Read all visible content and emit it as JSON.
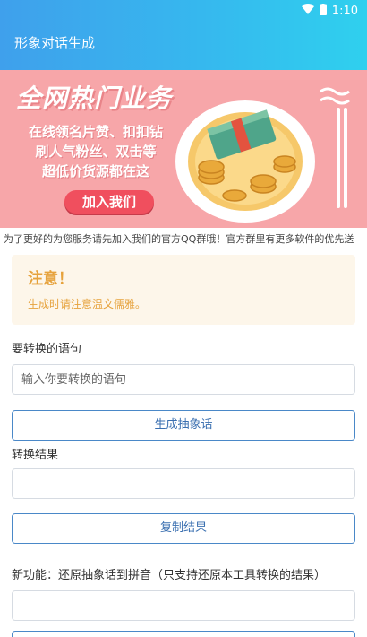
{
  "status": {
    "time": "1:10"
  },
  "app": {
    "title": "形象对话生成"
  },
  "banner": {
    "headline": "全网热门业务",
    "line1": "在线领名片赞、扣扣钻",
    "line2": "刷人气粉丝、双击等",
    "line3": "超低价货源都在这",
    "join_label": "加入我们"
  },
  "marquee": {
    "text": "为了更好的为您服务请先加入我们的官方QQ群哦！官方群里有更多软件的优先送"
  },
  "notice": {
    "title": "注意！",
    "text": "生成时请注意温文儒雅。"
  },
  "form": {
    "sentence_label": "要转换的语句",
    "sentence_placeholder": "输入你要转换的语句",
    "generate_label": "生成抽象话",
    "result_label": "转换结果",
    "result_value": "",
    "copy_label": "复制结果",
    "new_feature_label": "新功能：还原抽象话到拼音（只支持还原本工具转换的结果）",
    "restore_value": ""
  },
  "colors": {
    "header_start": "#3fa0ec",
    "header_end": "#2fd0ee",
    "notice_text": "#e6a23c",
    "button_border": "#4a88c8"
  }
}
